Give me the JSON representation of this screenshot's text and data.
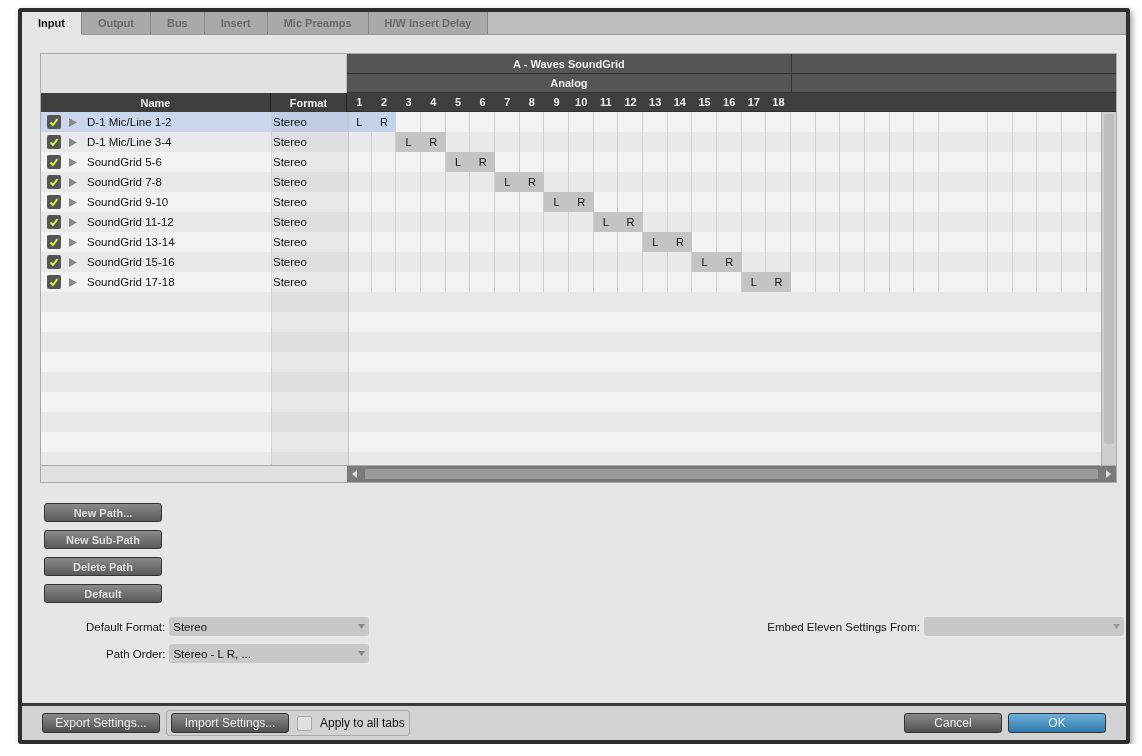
{
  "tabs": [
    {
      "label": "Input",
      "selected": true
    },
    {
      "label": "Output",
      "selected": false
    },
    {
      "label": "Bus",
      "selected": false
    },
    {
      "label": "Insert",
      "selected": false
    },
    {
      "label": "Mic Preamps",
      "selected": false
    },
    {
      "label": "H/W Insert Delay",
      "selected": false
    }
  ],
  "grid": {
    "device": "A - Waves SoundGrid",
    "group": "Analog",
    "channels": [
      "1",
      "2",
      "3",
      "4",
      "5",
      "6",
      "7",
      "8",
      "9",
      "10",
      "11",
      "12",
      "13",
      "14",
      "15",
      "16",
      "17",
      "18"
    ]
  },
  "columns": [
    "Name",
    "Format"
  ],
  "rows": [
    {
      "name": "D-1 Mic/Line 1-2",
      "format": "Stereo",
      "checked": true,
      "selected": true,
      "cells": [
        {
          "kind": "channel",
          "text": "L"
        },
        {
          "kind": "channel",
          "text": "R"
        }
      ]
    },
    {
      "name": "D-1 Mic/Line 3-4",
      "format": "Stereo",
      "checked": true,
      "selected": false,
      "cells": [
        {
          "kind": "blank"
        },
        {
          "kind": "blank"
        },
        {
          "kind": "channel",
          "text": "L"
        },
        {
          "kind": "channel",
          "text": "R"
        }
      ]
    },
    {
      "name": "SoundGrid 5-6",
      "format": "Stereo",
      "checked": true,
      "selected": false,
      "cells": [
        {
          "kind": "blank"
        },
        {
          "kind": "blank"
        },
        {
          "kind": "blank"
        },
        {
          "kind": "blank"
        },
        {
          "kind": "channel",
          "text": "L"
        },
        {
          "kind": "channel",
          "text": "R"
        }
      ]
    },
    {
      "name": "SoundGrid 7-8",
      "format": "Stereo",
      "checked": true,
      "selected": false,
      "cells": [
        {
          "kind": "blank"
        },
        {
          "kind": "blank"
        },
        {
          "kind": "blank"
        },
        {
          "kind": "blank"
        },
        {
          "kind": "blank"
        },
        {
          "kind": "blank"
        },
        {
          "kind": "channel",
          "text": "L"
        },
        {
          "kind": "channel",
          "text": "R"
        }
      ]
    },
    {
      "name": "SoundGrid 9-10",
      "format": "Stereo",
      "checked": true,
      "selected": false,
      "cells": [
        {
          "kind": "blank"
        },
        {
          "kind": "blank"
        },
        {
          "kind": "blank"
        },
        {
          "kind": "blank"
        },
        {
          "kind": "blank"
        },
        {
          "kind": "blank"
        },
        {
          "kind": "blank"
        },
        {
          "kind": "blank"
        },
        {
          "kind": "channel",
          "text": "L"
        },
        {
          "kind": "channel",
          "text": "R"
        }
      ]
    },
    {
      "name": "SoundGrid 11-12",
      "format": "Stereo",
      "checked": true,
      "selected": false,
      "cells": [
        {
          "kind": "blank"
        },
        {
          "kind": "blank"
        },
        {
          "kind": "blank"
        },
        {
          "kind": "blank"
        },
        {
          "kind": "blank"
        },
        {
          "kind": "blank"
        },
        {
          "kind": "blank"
        },
        {
          "kind": "blank"
        },
        {
          "kind": "blank"
        },
        {
          "kind": "blank"
        },
        {
          "kind": "channel",
          "text": "L"
        },
        {
          "kind": "channel",
          "text": "R"
        }
      ]
    },
    {
      "name": "SoundGrid 13-14",
      "format": "Stereo",
      "checked": true,
      "selected": false,
      "cells": [
        {
          "kind": "blank"
        },
        {
          "kind": "blank"
        },
        {
          "kind": "blank"
        },
        {
          "kind": "blank"
        },
        {
          "kind": "blank"
        },
        {
          "kind": "blank"
        },
        {
          "kind": "blank"
        },
        {
          "kind": "blank"
        },
        {
          "kind": "blank"
        },
        {
          "kind": "blank"
        },
        {
          "kind": "blank"
        },
        {
          "kind": "blank"
        },
        {
          "kind": "channel",
          "text": "L"
        },
        {
          "kind": "channel",
          "text": "R"
        }
      ]
    },
    {
      "name": "SoundGrid 15-16",
      "format": "Stereo",
      "checked": true,
      "selected": false,
      "cells": [
        {
          "kind": "blank"
        },
        {
          "kind": "blank"
        },
        {
          "kind": "blank"
        },
        {
          "kind": "blank"
        },
        {
          "kind": "blank"
        },
        {
          "kind": "blank"
        },
        {
          "kind": "blank"
        },
        {
          "kind": "blank"
        },
        {
          "kind": "blank"
        },
        {
          "kind": "blank"
        },
        {
          "kind": "blank"
        },
        {
          "kind": "blank"
        },
        {
          "kind": "blank"
        },
        {
          "kind": "blank"
        },
        {
          "kind": "channel",
          "text": "L"
        },
        {
          "kind": "channel",
          "text": "R"
        }
      ]
    },
    {
      "name": "SoundGrid 17-18",
      "format": "Stereo",
      "checked": true,
      "selected": false,
      "cells": [
        {
          "kind": "blank"
        },
        {
          "kind": "blank"
        },
        {
          "kind": "blank"
        },
        {
          "kind": "blank"
        },
        {
          "kind": "blank"
        },
        {
          "kind": "blank"
        },
        {
          "kind": "blank"
        },
        {
          "kind": "blank"
        },
        {
          "kind": "blank"
        },
        {
          "kind": "blank"
        },
        {
          "kind": "blank"
        },
        {
          "kind": "blank"
        },
        {
          "kind": "blank"
        },
        {
          "kind": "blank"
        },
        {
          "kind": "blank"
        },
        {
          "kind": "blank"
        },
        {
          "kind": "channel",
          "text": "L"
        },
        {
          "kind": "channel",
          "text": "R"
        }
      ]
    }
  ],
  "path_buttons": [
    "New Path...",
    "New Sub-Path",
    "Delete Path",
    "Default"
  ],
  "default_format": {
    "label": "Default Format:",
    "value": "Stereo"
  },
  "path_order": {
    "label": "Path Order:",
    "value": "Stereo - L R, ..."
  },
  "embed": {
    "label": "Embed Eleven Settings From:"
  },
  "footer": {
    "export": "Export Settings...",
    "import": "Import Settings...",
    "apply_all": {
      "label": "Apply to all tabs",
      "checked": false
    },
    "cancel": "Cancel",
    "ok": "OK"
  }
}
